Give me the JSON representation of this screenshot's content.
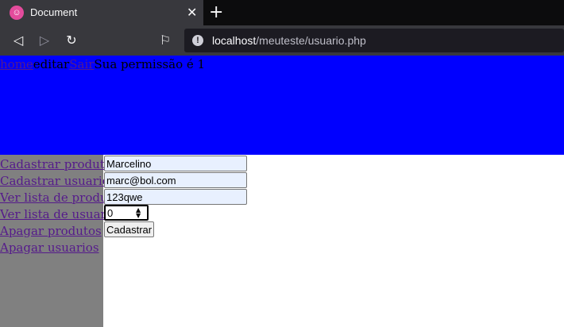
{
  "browser": {
    "tab_title": "Document",
    "url_host": "localhost",
    "url_path": "/meuteste/usuario.php"
  },
  "header": {
    "home": "home",
    "editar": "editar",
    "sair": "Sair",
    "permission_text": "Sua permissão é 1"
  },
  "sidebar": {
    "items": [
      {
        "label": "Cadastrar produto"
      },
      {
        "label": "Cadastrar usuario"
      },
      {
        "label": "Ver lista de produtos"
      },
      {
        "label": "Ver lista de usuarios"
      },
      {
        "label": "Apagar produtos"
      },
      {
        "label": "Apagar usuarios"
      }
    ]
  },
  "form": {
    "name_value": "Marcelino",
    "email_value": "marc@bol.com",
    "password_value": "123qwe",
    "level_value": "0",
    "submit_label": "Cadastrar"
  },
  "colors": {
    "header_bg": "#0000ff",
    "sidebar_bg": "#808080",
    "autofill_bg": "#e8f0fe"
  }
}
